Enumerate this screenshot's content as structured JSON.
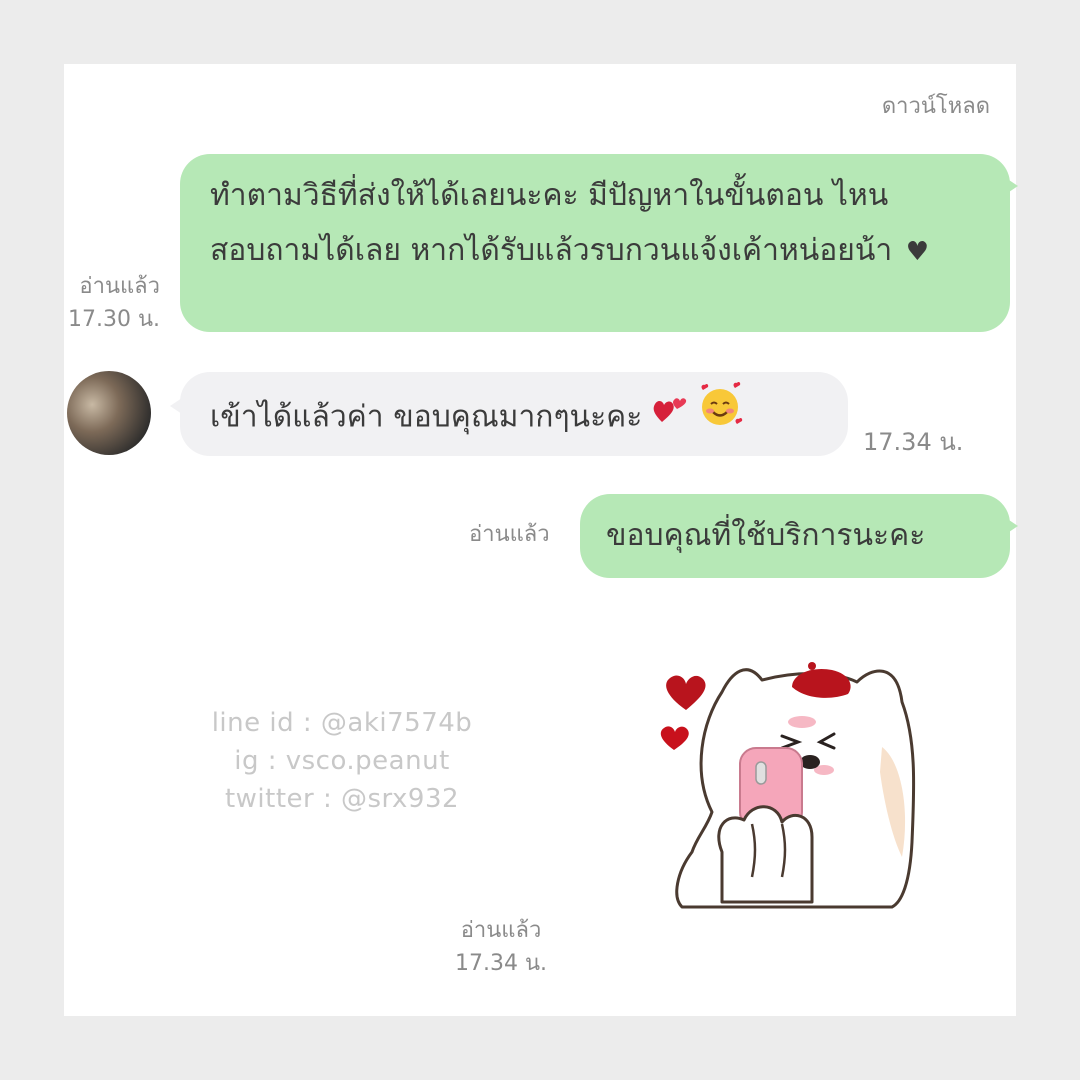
{
  "header": {
    "download_label": "ดาวน์โหลด"
  },
  "messages": [
    {
      "side": "out",
      "text": "ทำตามวิธีที่ส่งให้ได้เลยนะคะ มีปัญหาในขั้นตอน ไหน สอบถามได้เลย หากได้รับแล้วรบกวนแจ้งเค้าหน่อยน้า",
      "heart": "♥",
      "read_label": "อ่านแล้ว",
      "time": "17.30 น."
    },
    {
      "side": "in",
      "text": "เข้าได้แล้วค่า ขอบคุณมากๆนะคะ",
      "time": "17.34 น."
    },
    {
      "side": "out",
      "text": "ขอบคุณที่ใช้บริการนะคะ",
      "read_label": "อ่านแล้ว"
    },
    {
      "side": "out",
      "type": "sticker",
      "read_label": "อ่านแล้ว",
      "time": "17.34 น."
    }
  ],
  "watermark": {
    "line_id": "line id : @aki7574b",
    "ig": "ig : vsco.peanut",
    "twitter": "twitter : @srx932"
  },
  "colors": {
    "outgoing_bubble": "#b6e8b6",
    "incoming_bubble": "#f1f1f3",
    "meta_text": "#8a8a8a"
  },
  "icons": {
    "emoji_1": "two-hearts-icon",
    "emoji_2": "smiling-face-with-hearts-icon",
    "avatar": "user-avatar"
  }
}
